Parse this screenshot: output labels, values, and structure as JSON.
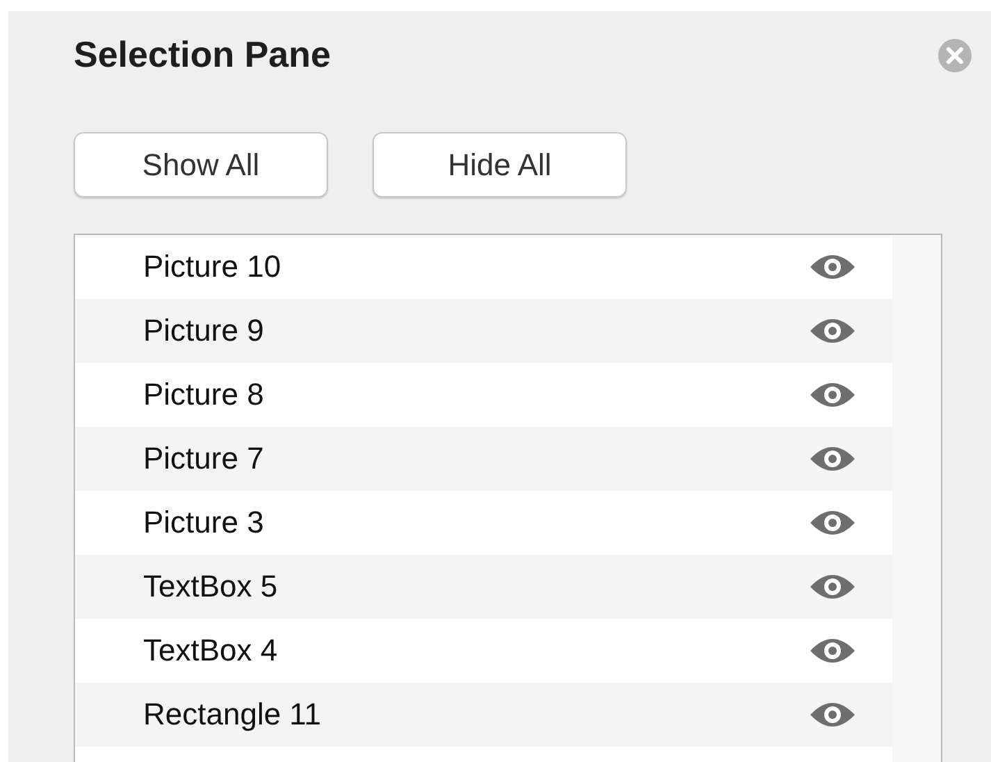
{
  "pane": {
    "title": "Selection Pane"
  },
  "buttons": [
    {
      "label": "Show All"
    },
    {
      "label": "Hide All"
    }
  ],
  "items": [
    {
      "name": "Picture 10",
      "visible": true
    },
    {
      "name": "Picture 9",
      "visible": true
    },
    {
      "name": "Picture 8",
      "visible": true
    },
    {
      "name": "Picture 7",
      "visible": true
    },
    {
      "name": "Picture 3",
      "visible": true
    },
    {
      "name": "TextBox 5",
      "visible": true
    },
    {
      "name": "TextBox 4",
      "visible": true
    },
    {
      "name": "Rectangle 11",
      "visible": true
    }
  ]
}
